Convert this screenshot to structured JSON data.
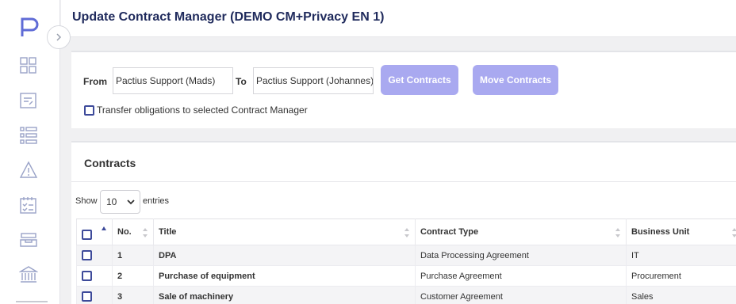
{
  "app": {
    "title": "Update Contract Manager (DEMO CM+Privacy EN 1)"
  },
  "sidebar": {
    "logo_icon": "pactius-logo-icon",
    "items": [
      {
        "icon": "dashboard-grid-icon"
      },
      {
        "icon": "document-edit-icon"
      },
      {
        "icon": "list-icon"
      },
      {
        "icon": "warning-icon"
      },
      {
        "icon": "calendar-check-icon"
      },
      {
        "icon": "inbox-tray-icon"
      },
      {
        "icon": "bank-icon"
      }
    ]
  },
  "transfer_form": {
    "from_label": "From",
    "from_value": "Pactius Support (Mads)",
    "to_label": "To",
    "to_value": "Pactius Support (Johannes)",
    "get_contracts_label": "Get Contracts",
    "move_contracts_label": "Move Contracts",
    "transfer_obligations_label": "Transfer obligations to selected Contract Manager"
  },
  "contracts": {
    "title": "Contracts",
    "show_label": "Show",
    "entries_label": "entries",
    "page_size": "10",
    "columns": [
      "No.",
      "Title",
      "Contract Type",
      "Business Unit"
    ],
    "rows": [
      {
        "no": "1",
        "title": "DPA",
        "type": "Data Processing Agreement",
        "unit": "IT"
      },
      {
        "no": "2",
        "title": "Purchase of equipment",
        "type": "Purchase Agreement",
        "unit": "Procurement"
      },
      {
        "no": "3",
        "title": "Sale of machinery",
        "type": "Customer Agreement",
        "unit": "Sales"
      }
    ]
  },
  "colors": {
    "accent": "#1f2a5c",
    "button": "#a9a9f0",
    "checkbox_border": "#3d4a9a",
    "nav_icon": "#9aa3c8"
  }
}
